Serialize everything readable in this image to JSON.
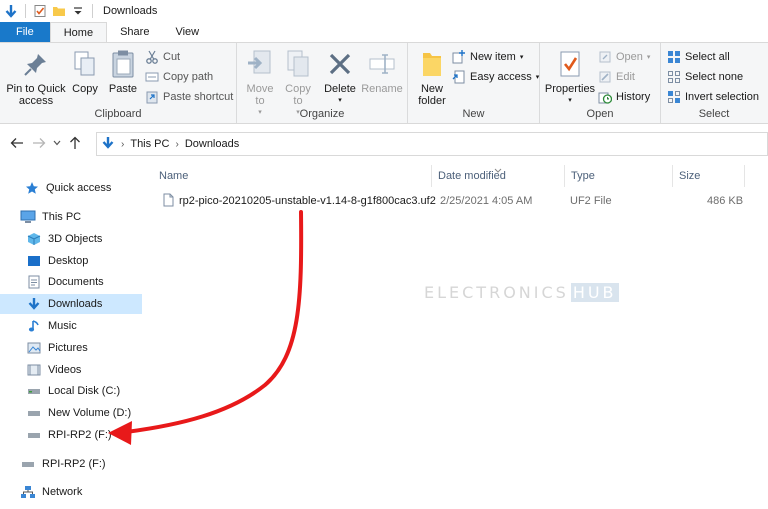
{
  "window": {
    "title": "Downloads"
  },
  "tabs": [
    {
      "label": "File"
    },
    {
      "label": "Home"
    },
    {
      "label": "Share"
    },
    {
      "label": "View"
    }
  ],
  "ribbon": {
    "clipboard": {
      "label": "Clipboard",
      "pin": "Pin to Quick access",
      "copy": "Copy",
      "paste": "Paste",
      "cut": "Cut",
      "copy_path": "Copy path",
      "paste_shortcut": "Paste shortcut"
    },
    "organize": {
      "label": "Organize",
      "move_to": "Move to",
      "copy_to": "Copy to",
      "delete": "Delete",
      "rename": "Rename"
    },
    "new": {
      "label": "New",
      "new_folder": "New folder",
      "new_item": "New item",
      "easy_access": "Easy access"
    },
    "open": {
      "label": "Open",
      "properties": "Properties",
      "open": "Open",
      "edit": "Edit",
      "history": "History"
    },
    "select": {
      "label": "Select",
      "select_all": "Select all",
      "select_none": "Select none",
      "invert_selection": "Invert selection"
    }
  },
  "address": {
    "crumbs": [
      "This PC",
      "Downloads"
    ]
  },
  "nav": {
    "quick_access": "Quick access",
    "this_pc": "This PC",
    "objects_3d": "3D Objects",
    "desktop": "Desktop",
    "documents": "Documents",
    "downloads": "Downloads",
    "music": "Music",
    "pictures": "Pictures",
    "videos": "Videos",
    "local_disk": "Local Disk (C:)",
    "new_volume": "New Volume (D:)",
    "rpi_drive": "RPI-RP2 (F:)",
    "rpi_drive_root": "RPI-RP2 (F:)",
    "network": "Network"
  },
  "columns": {
    "name": "Name",
    "date": "Date modified",
    "type": "Type",
    "size": "Size"
  },
  "files": [
    {
      "name": "rp2-pico-20210205-unstable-v1.14-8-g1f800cac3.uf2",
      "date": "2/25/2021 4:05 AM",
      "type": "UF2 File",
      "size": "486 KB"
    }
  ],
  "watermark": {
    "main": "ELECTRONICS",
    "suffix": "HUB"
  },
  "colors": {
    "accent": "#1979ca",
    "selection": "#cde8ff",
    "arrow": "#e8191a"
  }
}
